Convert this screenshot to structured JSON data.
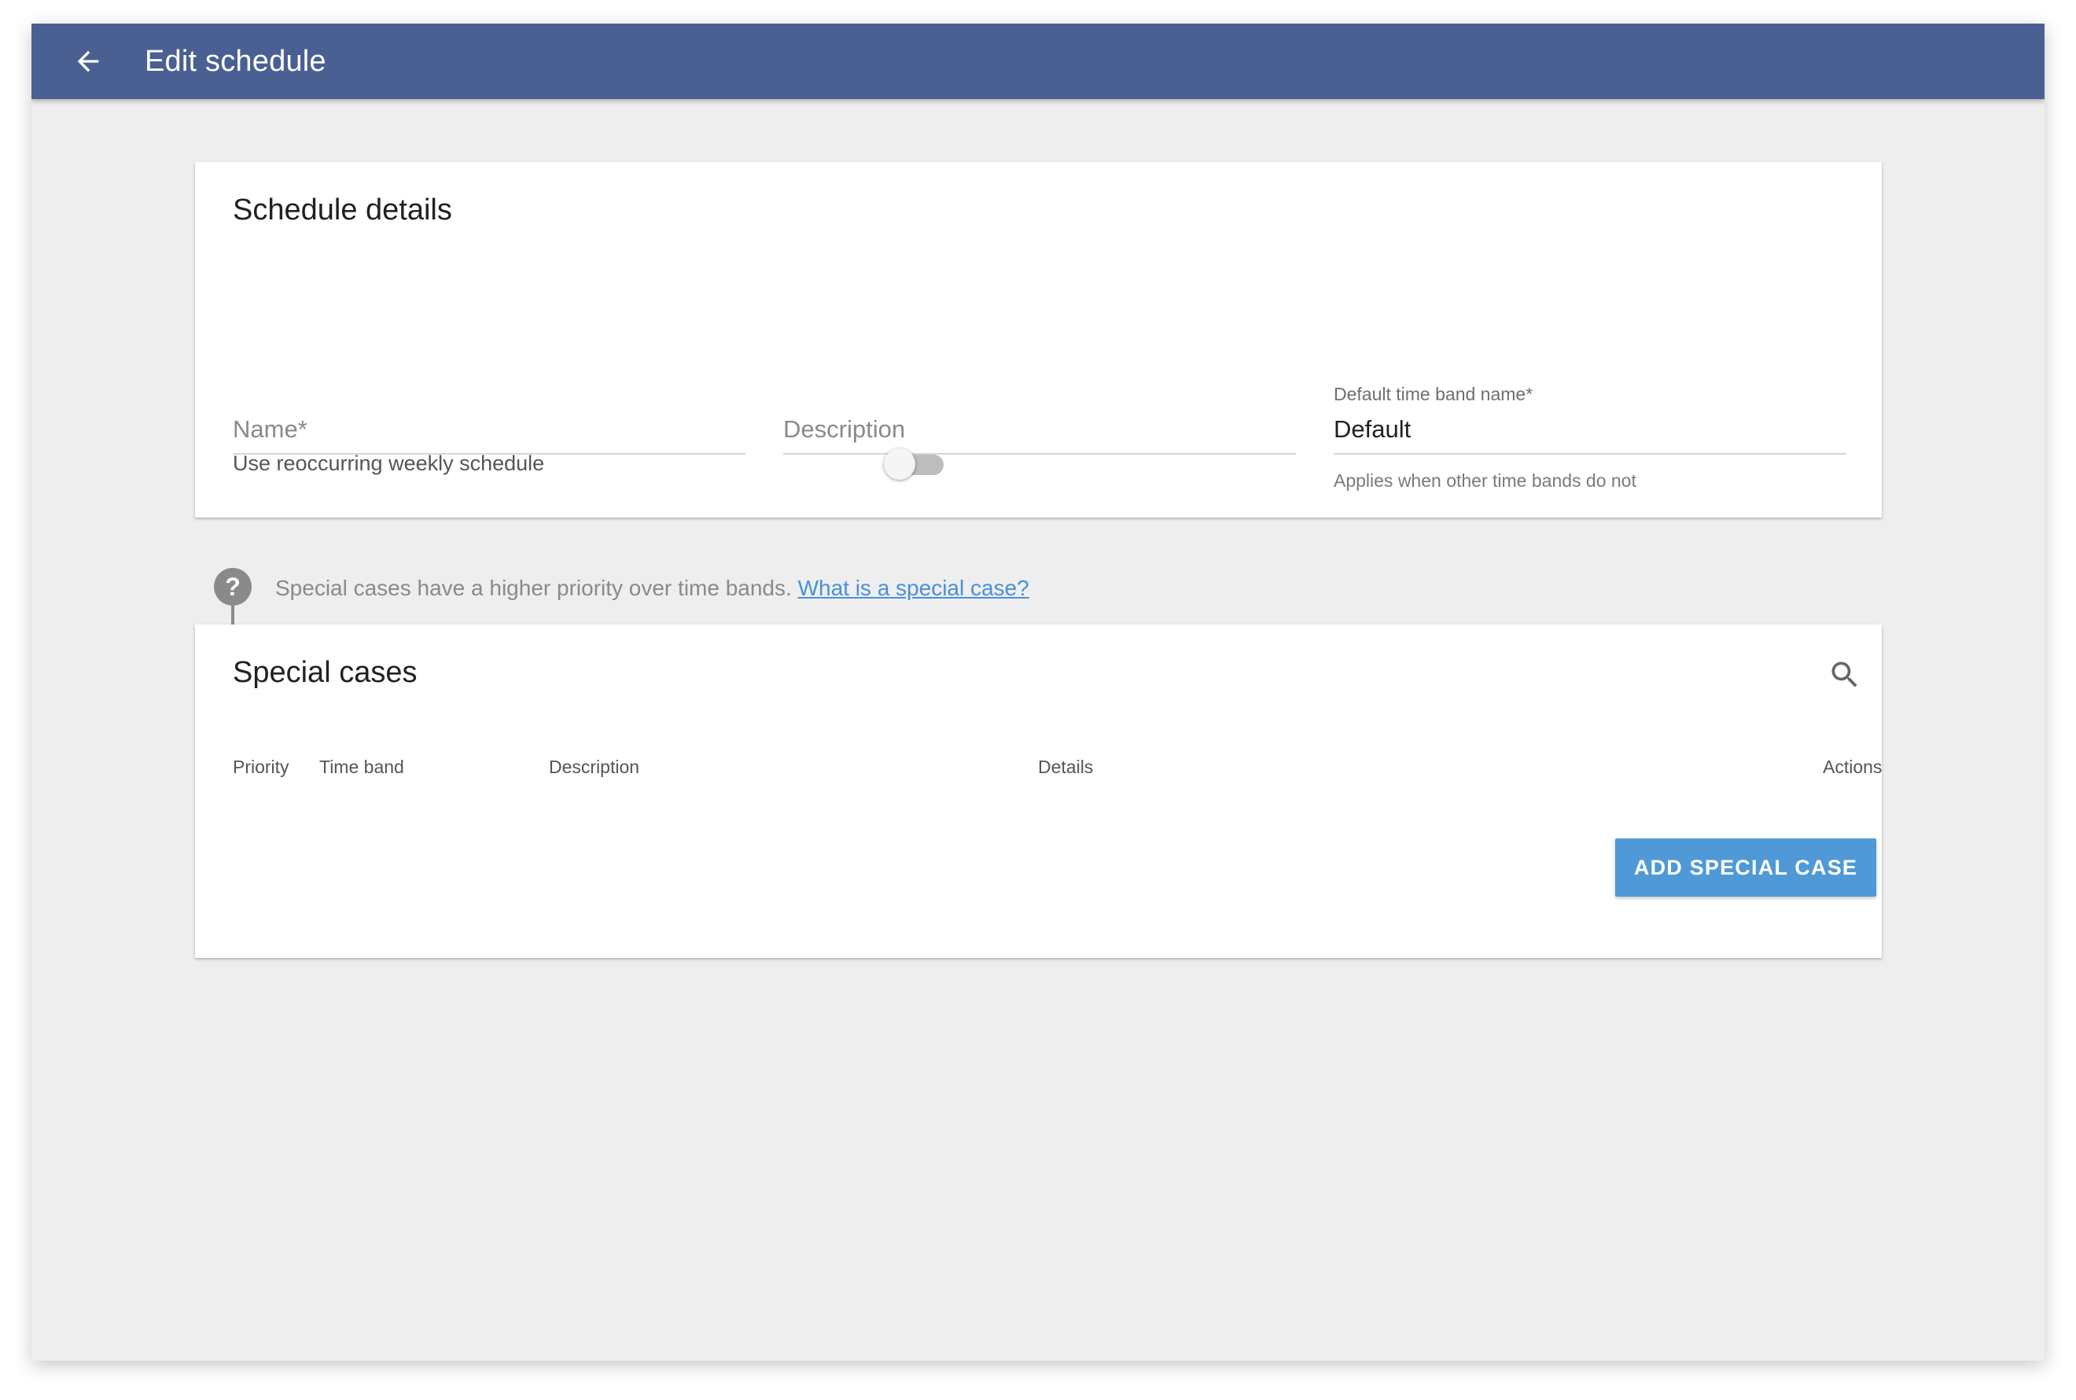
{
  "appbar": {
    "title": "Edit schedule",
    "back_icon": "arrow-left-icon",
    "color": "#4a6093"
  },
  "schedule_details": {
    "title": "Schedule details",
    "name_field": {
      "placeholder": "Name*",
      "value": ""
    },
    "description_field": {
      "placeholder": "Description",
      "value": ""
    },
    "default_time_band_field": {
      "label": "Default time band name*",
      "value": "Default",
      "helper": "Applies when other time bands do not"
    },
    "weekly_toggle": {
      "label": "Use reoccurring weekly schedule",
      "checked": false
    }
  },
  "info": {
    "icon": "help-circle-icon",
    "text": "Special cases have a higher priority over time bands. ",
    "link_text": "What is a special case?",
    "link_color": "#4a90d9"
  },
  "special_cases": {
    "title": "Special cases",
    "search_icon": "search-icon",
    "columns": [
      "Priority",
      "Time band",
      "Description",
      "Details",
      "Actions"
    ],
    "rows": [],
    "add_button_label": "ADD SPECIAL CASE",
    "add_button_color": "#4f9ad6"
  }
}
